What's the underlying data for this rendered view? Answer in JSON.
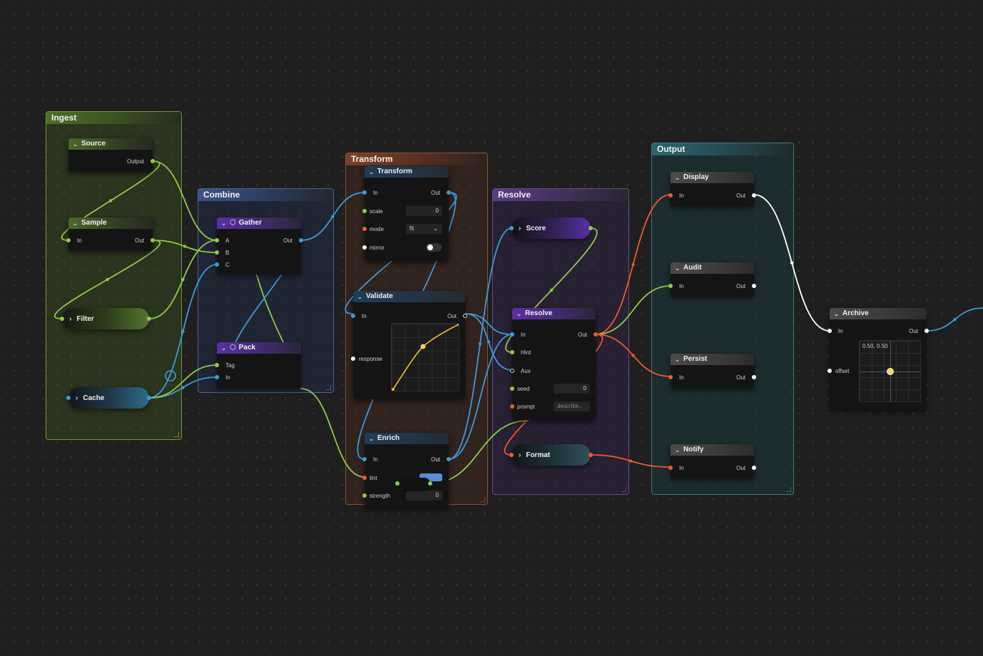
{
  "frames": {
    "ingest": "Ingest",
    "combine": "Combine",
    "transform": "Transform",
    "resolve": "Resolve",
    "output": "Output"
  },
  "nodes": {
    "source": {
      "title": "Source",
      "out": "Output"
    },
    "sample": {
      "title": "Sample",
      "in": "In",
      "out": "Out"
    },
    "filter": {
      "title": "Filter"
    },
    "cache": {
      "title": "Cache"
    },
    "gather": {
      "title": "Gather",
      "a": "A",
      "b": "B",
      "c": "C",
      "out": "Out"
    },
    "pack": {
      "title": "Pack",
      "tag": "Tag",
      "in": "In"
    },
    "transform": {
      "title": "Transform",
      "in": "In",
      "out": "Out",
      "scale_label": "scale",
      "scale_value": "0",
      "mode_label": "mode",
      "mode_value": "fit",
      "mirror_label": "mirror",
      "mirror_on": false
    },
    "validate": {
      "title": "Validate",
      "in": "In",
      "out": "Out",
      "response_label": "response"
    },
    "enrich": {
      "title": "Enrich",
      "in": "In",
      "out": "Out",
      "tint_label": "tint",
      "tint_color": "#5a8fd8",
      "strength_label": "strength",
      "strength_value": "0"
    },
    "score": {
      "title": "Score"
    },
    "resolve": {
      "title": "Resolve",
      "in": "In",
      "out": "Out",
      "hint": "Hint",
      "aux": "Aux",
      "seed_label": "seed",
      "seed_value": "0",
      "prompt_label": "prompt",
      "prompt_placeholder": "describe.."
    },
    "format": {
      "title": "Format"
    },
    "display": {
      "title": "Display",
      "in": "In",
      "out": "Out"
    },
    "audit": {
      "title": "Audit",
      "in": "In",
      "out": "Out"
    },
    "persist": {
      "title": "Persist",
      "in": "In",
      "out": "Out"
    },
    "notify": {
      "title": "Notify",
      "in": "In",
      "out": "Out"
    },
    "archive": {
      "title": "Archive",
      "in": "In",
      "out": "Out",
      "offset_label": "offset",
      "offset_readout": "0.50, 0.50"
    }
  },
  "colors": {
    "green": "#8ecb46",
    "blue": "#3d9ad8",
    "orange": "#ef5a2c",
    "white": "#ffffff",
    "curve": "#f2b632"
  }
}
